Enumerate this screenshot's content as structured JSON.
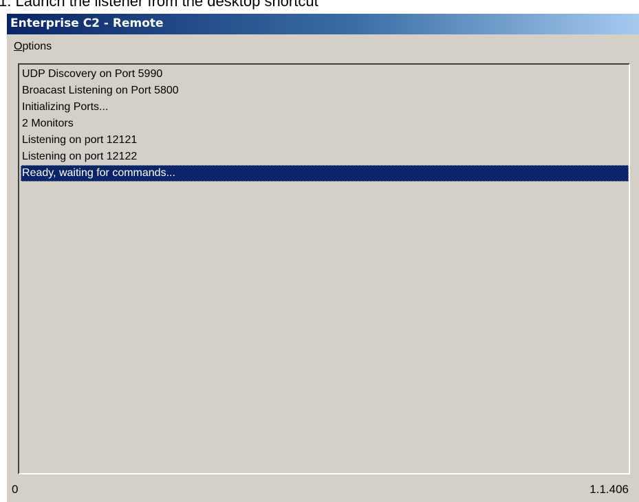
{
  "document": {
    "caption": "1.   Launch the listener from the desktop shortcut"
  },
  "window": {
    "title": "Enterprise C2 - Remote",
    "colors": {
      "titlebar_start": "#0a246a",
      "titlebar_end": "#a6caf0",
      "face": "#d4d0c8",
      "selection": "#0a246a"
    }
  },
  "menu": {
    "options_mnemonic": "O",
    "options_rest": "ptions"
  },
  "log": {
    "items": [
      "UDP Discovery on Port 5990",
      "Broacast Listening on Port 5800",
      "Initializing Ports...",
      "2 Monitors",
      "Listening on port 12121",
      "Listening on port 12122",
      "Ready, waiting for commands..."
    ],
    "selected_index": 6
  },
  "status": {
    "left": "0",
    "version": "1.1.406"
  }
}
